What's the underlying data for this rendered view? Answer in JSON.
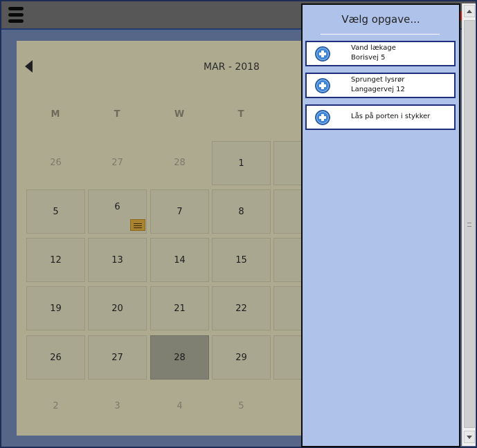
{
  "calendar": {
    "month_label": "MAR - 2018",
    "weekdays": [
      "M",
      "T",
      "W",
      "T"
    ],
    "rows": [
      [
        {
          "day": "26",
          "out": true
        },
        {
          "day": "27",
          "out": true
        },
        {
          "day": "28",
          "out": true
        },
        {
          "day": "1",
          "out": false
        }
      ],
      [
        {
          "day": "5",
          "out": false
        },
        {
          "day": "6",
          "out": false,
          "has_note": true
        },
        {
          "day": "7",
          "out": false
        },
        {
          "day": "8",
          "out": false
        }
      ],
      [
        {
          "day": "12",
          "out": false
        },
        {
          "day": "13",
          "out": false
        },
        {
          "day": "14",
          "out": false
        },
        {
          "day": "15",
          "out": false
        }
      ],
      [
        {
          "day": "19",
          "out": false
        },
        {
          "day": "20",
          "out": false
        },
        {
          "day": "21",
          "out": false
        },
        {
          "day": "22",
          "out": false
        }
      ],
      [
        {
          "day": "26",
          "out": false
        },
        {
          "day": "27",
          "out": false
        },
        {
          "day": "28",
          "out": false,
          "selected": true
        },
        {
          "day": "29",
          "out": false
        }
      ],
      [
        {
          "day": "2",
          "out": true
        },
        {
          "day": "3",
          "out": true
        },
        {
          "day": "4",
          "out": true
        },
        {
          "day": "5",
          "out": true
        }
      ]
    ]
  },
  "panel": {
    "title": "Vælg opgave...",
    "tasks": [
      {
        "line1": "Vand lækage",
        "line2": "Borisvej 5"
      },
      {
        "line1": "Sprunget lysrør",
        "line2": "Langagervej 12"
      },
      {
        "line1": "Lås på porten i stykker",
        "line2": ""
      }
    ]
  },
  "icons": {
    "menu": "hamburger-menu-icon",
    "prev": "chevron-left-icon",
    "task": "plus-circle-icon",
    "note": "note-icon"
  },
  "colors": {
    "panel_bg": "#afc3ea",
    "task_border": "#1d2e7a",
    "plus_icon": "#3f86d8",
    "selected_day": "#7f7f72",
    "note_badge": "#a9832f"
  }
}
